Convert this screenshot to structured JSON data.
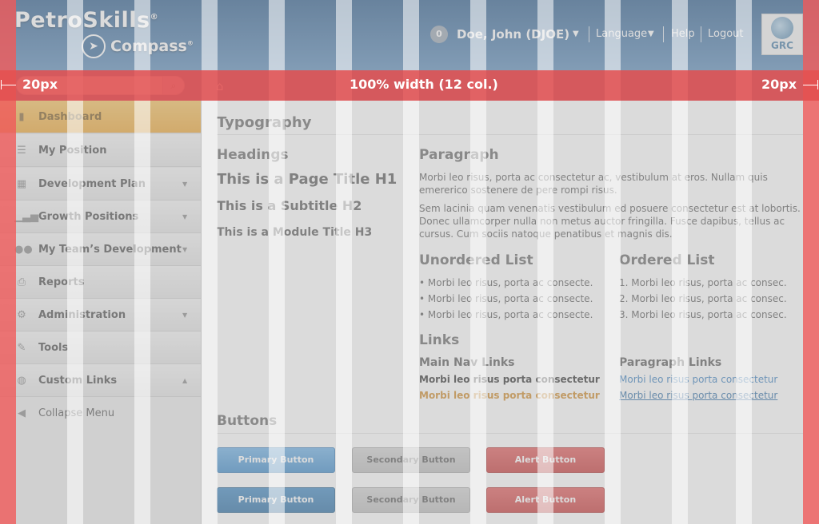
{
  "header": {
    "brand_top": "PetroSkills",
    "brand_top_mark": "®",
    "brand_bottom": "Compass",
    "brand_bottom_mark": "®",
    "notification_count": "0",
    "user_name": "Doe, John (DJOE)",
    "language_label": "Language",
    "help_label": "Help",
    "logout_label": "Logout",
    "grc_label": "GRC"
  },
  "sidebar": {
    "items": [
      {
        "label": "Dashboard",
        "icon": "bar-chart-icon",
        "active": true,
        "caret": ""
      },
      {
        "label": "My Position",
        "icon": "list-icon",
        "caret": ""
      },
      {
        "label": "Development Plan",
        "icon": "calendar-icon",
        "caret": "▼"
      },
      {
        "label": "Growth Positions",
        "icon": "signal-icon",
        "caret": "▼"
      },
      {
        "label": "My Team’s Development",
        "icon": "team-icon",
        "caret": "▼"
      },
      {
        "label": "Reports",
        "icon": "printer-icon",
        "caret": ""
      },
      {
        "label": "Administration",
        "icon": "gears-icon",
        "caret": "▼"
      },
      {
        "label": "Tools",
        "icon": "wrench-icon",
        "caret": ""
      },
      {
        "label": "Custom Links",
        "icon": "globe-icon",
        "caret": "▲"
      }
    ],
    "collapse_label": "Collapse Menu"
  },
  "main": {
    "typography_title": "Typography",
    "headings_title": "Headings",
    "h1_sample": "This is a Page Title H1",
    "h2_sample": "This is a Subtitle H2",
    "h3_sample": "This is a Module Title H3",
    "paragraph_title": "Paragraph",
    "paragraph_1": "Morbi leo risus, porta ac consectetur ac, vestibulum at eros. Nullam quis emererico sostenere de pere rompi risus.",
    "paragraph_2": "Sem lacinia quam venenatis vestibulum ed posuere consectetur est at lobortis. Donec ullamcorper nulla non metus auctor fringilla. Fusce dapibus, tellus ac cursus. Cum sociis natoque penatibus et magnis dis.",
    "unordered_title": "Unordered List",
    "unordered_items": [
      "• Morbi leo risus, porta ac consecte.",
      "• Morbi leo risus, porta ac consecte.",
      "• Morbi leo risus, porta ac consecte."
    ],
    "ordered_title": "Ordered List",
    "ordered_items": [
      "1. Morbi leo risus, porta ac consec.",
      "2. Morbi leo risus, porta ac consec.",
      "3. Morbi leo risus, porta ac consec."
    ],
    "links_title": "Links",
    "main_nav_links_title": "Main Nav Links",
    "main_nav_link_1": "Morbi leo risus porta consectetur",
    "main_nav_link_2": "Morbi leo risus porta consectetur",
    "paragraph_links_title": "Paragraph Links",
    "paragraph_link_1": "Morbi leo risus porta consectetur",
    "paragraph_link_2": "Morbi leo risus porta consectetur",
    "buttons_title": "Buttons",
    "primary_button": "Primary Button",
    "secondary_button": "Secondary Button",
    "alert_button": "Alert Button"
  },
  "overlay": {
    "left_margin_label": "20px",
    "center_label": "100% width (12 col.)",
    "right_margin_label": "20px"
  },
  "colors": {
    "header_blue": "#3f6f9f",
    "active_nav": "#eea737",
    "primary": "#3f8ccb",
    "alert": "#c93b3b",
    "link_blue": "#3a7fbf",
    "link_orange": "#d08a2a",
    "grid_margin": "#f05a5a"
  }
}
